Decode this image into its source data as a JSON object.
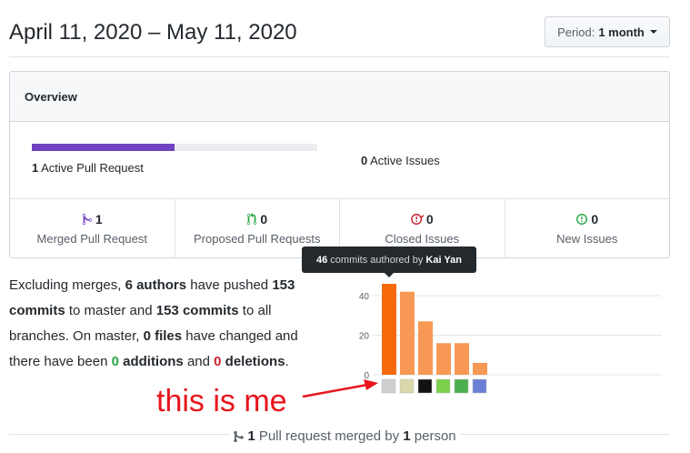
{
  "header": {
    "date_range": "April 11, 2020 – May 11, 2020",
    "period_prefix": "Period:",
    "period_value": "1 month"
  },
  "overview": {
    "title": "Overview",
    "active_pr_count": "1",
    "active_pr_label": "Active Pull Request",
    "active_pr_fill": 0.5,
    "active_issues_count": "0",
    "active_issues_label": "Active Issues",
    "stats": [
      {
        "count": "1",
        "label": "Merged Pull Request",
        "icon": "merge-icon",
        "color": "#6f42c1"
      },
      {
        "count": "0",
        "label": "Proposed Pull Requests",
        "icon": "pull-request-icon",
        "color": "#28a745"
      },
      {
        "count": "0",
        "label": "Closed Issues",
        "icon": "issue-closed-icon",
        "color": "#cb2431"
      },
      {
        "count": "0",
        "label": "New Issues",
        "icon": "issue-opened-icon",
        "color": "#28a745"
      }
    ]
  },
  "summary": {
    "t1": "Excluding merges, ",
    "authors": "6 authors",
    "t2": " have pushed ",
    "commits_master": "153 commits",
    "t3": " to master and ",
    "commits_all": "153 commits",
    "t4": " to all branches. On master, ",
    "files": "0 files",
    "t5": " have changed and there have been ",
    "additions_num": "0",
    "additions_word": " additions",
    "t6": " and ",
    "deletions_num": "0",
    "deletions_word": " deletions",
    "t7": "."
  },
  "tooltip": {
    "count": "46",
    "text": "commits authored by",
    "author": "Kai Yan"
  },
  "chart_data": {
    "type": "bar",
    "categories": [
      "author-1",
      "author-2",
      "author-3",
      "author-4",
      "author-5",
      "author-6"
    ],
    "values": [
      46,
      42,
      27,
      16,
      16,
      6
    ],
    "ylim": [
      0,
      50
    ],
    "yticks": [
      "0",
      "20",
      "40"
    ],
    "ytick_values": [
      0,
      20,
      40
    ],
    "highlight_index": 0,
    "colors": {
      "highlight": "#f66a0a",
      "normal": "#f79954",
      "grid": "#e1e4e8"
    }
  },
  "annotation": {
    "text": "this is me",
    "color": "#e8141b"
  },
  "footer": {
    "count": "1",
    "t1": " Pull request merged by ",
    "people": "1",
    "t2": " person"
  }
}
